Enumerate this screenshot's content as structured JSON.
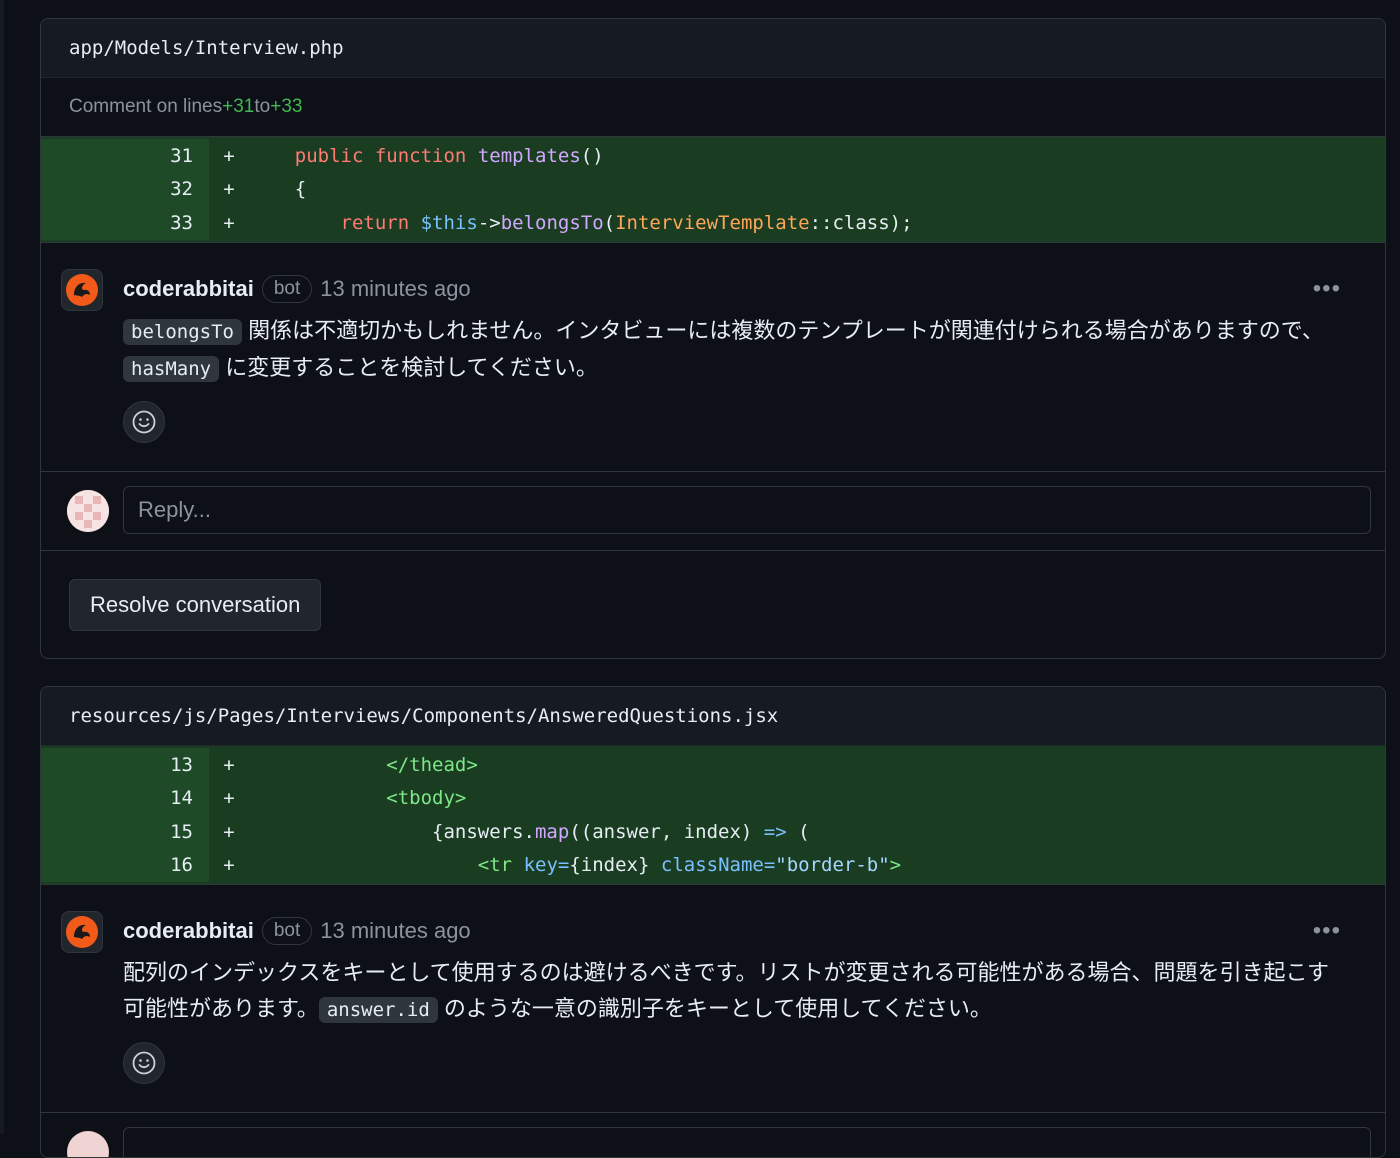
{
  "threads": [
    {
      "file_path": "app/Models/Interview.php",
      "comment_lines": {
        "prefix": "Comment on lines ",
        "start": "+31",
        "middle": " to ",
        "end": "+33"
      },
      "diff": [
        {
          "num": "31",
          "sign": "+"
        },
        {
          "num": "32",
          "sign": "+"
        },
        {
          "num": "33",
          "sign": "+"
        }
      ],
      "comment": {
        "author": "coderabbitai",
        "badge": "bot",
        "time": "13 minutes ago",
        "code1": "belongsTo",
        "text1": " 関係は不適切かもしれません。インタビューには複数のテンプレートが関連付けられる場合がありますので、",
        "code2": "hasMany",
        "text2": " に変更することを検討してください。"
      },
      "reply_placeholder": "Reply...",
      "resolve_label": "Resolve conversation"
    },
    {
      "file_path": "resources/js/Pages/Interviews/Components/AnsweredQuestions.jsx",
      "diff": [
        {
          "num": "13",
          "sign": "+"
        },
        {
          "num": "14",
          "sign": "+"
        },
        {
          "num": "15",
          "sign": "+"
        },
        {
          "num": "16",
          "sign": "+"
        }
      ],
      "comment": {
        "author": "coderabbitai",
        "badge": "bot",
        "time": "13 minutes ago",
        "text1": "配列のインデックスをキーとして使用するのは避けるべきです。リストが変更される可能性がある場合、問題を引き起こす可能性があります。",
        "code1": "answer.id",
        "text2": " のような一意の識別子をキーとして使用してください。"
      }
    }
  ],
  "code": {
    "t1_l31": {
      "kw1": "public",
      "kw2": "function",
      "fn": "templates",
      "rest": "()"
    },
    "t1_l32": {
      "brace": "{"
    },
    "t1_l33": {
      "kw": "return",
      "var": "$this",
      "arrow": "->",
      "fn": "belongsTo",
      "p1": "(",
      "cls": "InterviewTemplate",
      "rest": "::class);"
    },
    "t2_l13": {
      "tag": "</thead>"
    },
    "t2_l14": {
      "tag": "<tbody>"
    },
    "t2_l15": {
      "a": "{answers.",
      "fn": "map",
      "b": "((answer, index) ",
      "op": "=>",
      "c": " ("
    },
    "t2_l16": {
      "tag": "<tr",
      "attr1": "key",
      "eq1": "=",
      "v1": "{index}",
      "attr2": "className",
      "eq2": "=",
      "v2": "\"border-b\"",
      "close": ">"
    }
  },
  "icons": {
    "bot_avatar": "rabbit-logo-icon",
    "emoji": "smiley-icon",
    "more": "kebab-icon",
    "user_avatar": "identicon-avatar"
  },
  "more_glyph": "•••",
  "colors": {
    "bg": "#0d1117",
    "diff_add": "#1a3d22",
    "accent_add": "#3fb950",
    "bot_orange": "#f25a1a"
  }
}
